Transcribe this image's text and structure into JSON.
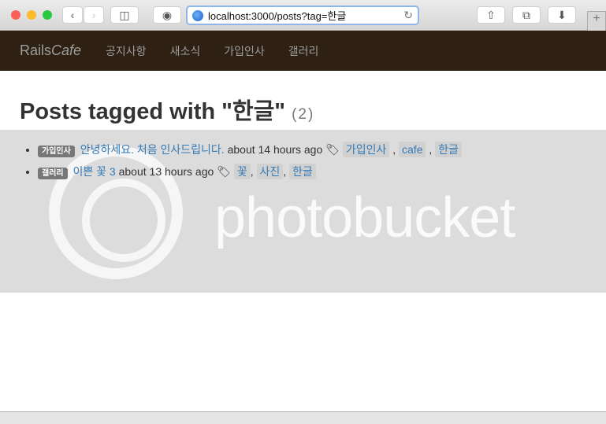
{
  "browser": {
    "url": "localhost:3000/posts?tag=한글",
    "new_tab": "+"
  },
  "nav": {
    "brand_plain": "Rails",
    "brand_italic": "Cafe",
    "items": [
      "공지사항",
      "새소식",
      "가입인사",
      "갤러리"
    ]
  },
  "page": {
    "title": "Posts tagged with \"한글\"",
    "count": "(2)"
  },
  "posts": [
    {
      "category": "가입인사",
      "title": "안녕하세요. 처음 인사드립니다.",
      "time": "about 14 hours ago",
      "tags": [
        "가입인사",
        "cafe",
        "한글"
      ]
    },
    {
      "category": "갤러리",
      "title": "이쁜 꽃 3",
      "time": "about 13 hours ago",
      "tags": [
        "꽃",
        "사진",
        "한글"
      ]
    }
  ],
  "watermark": "photobucket"
}
